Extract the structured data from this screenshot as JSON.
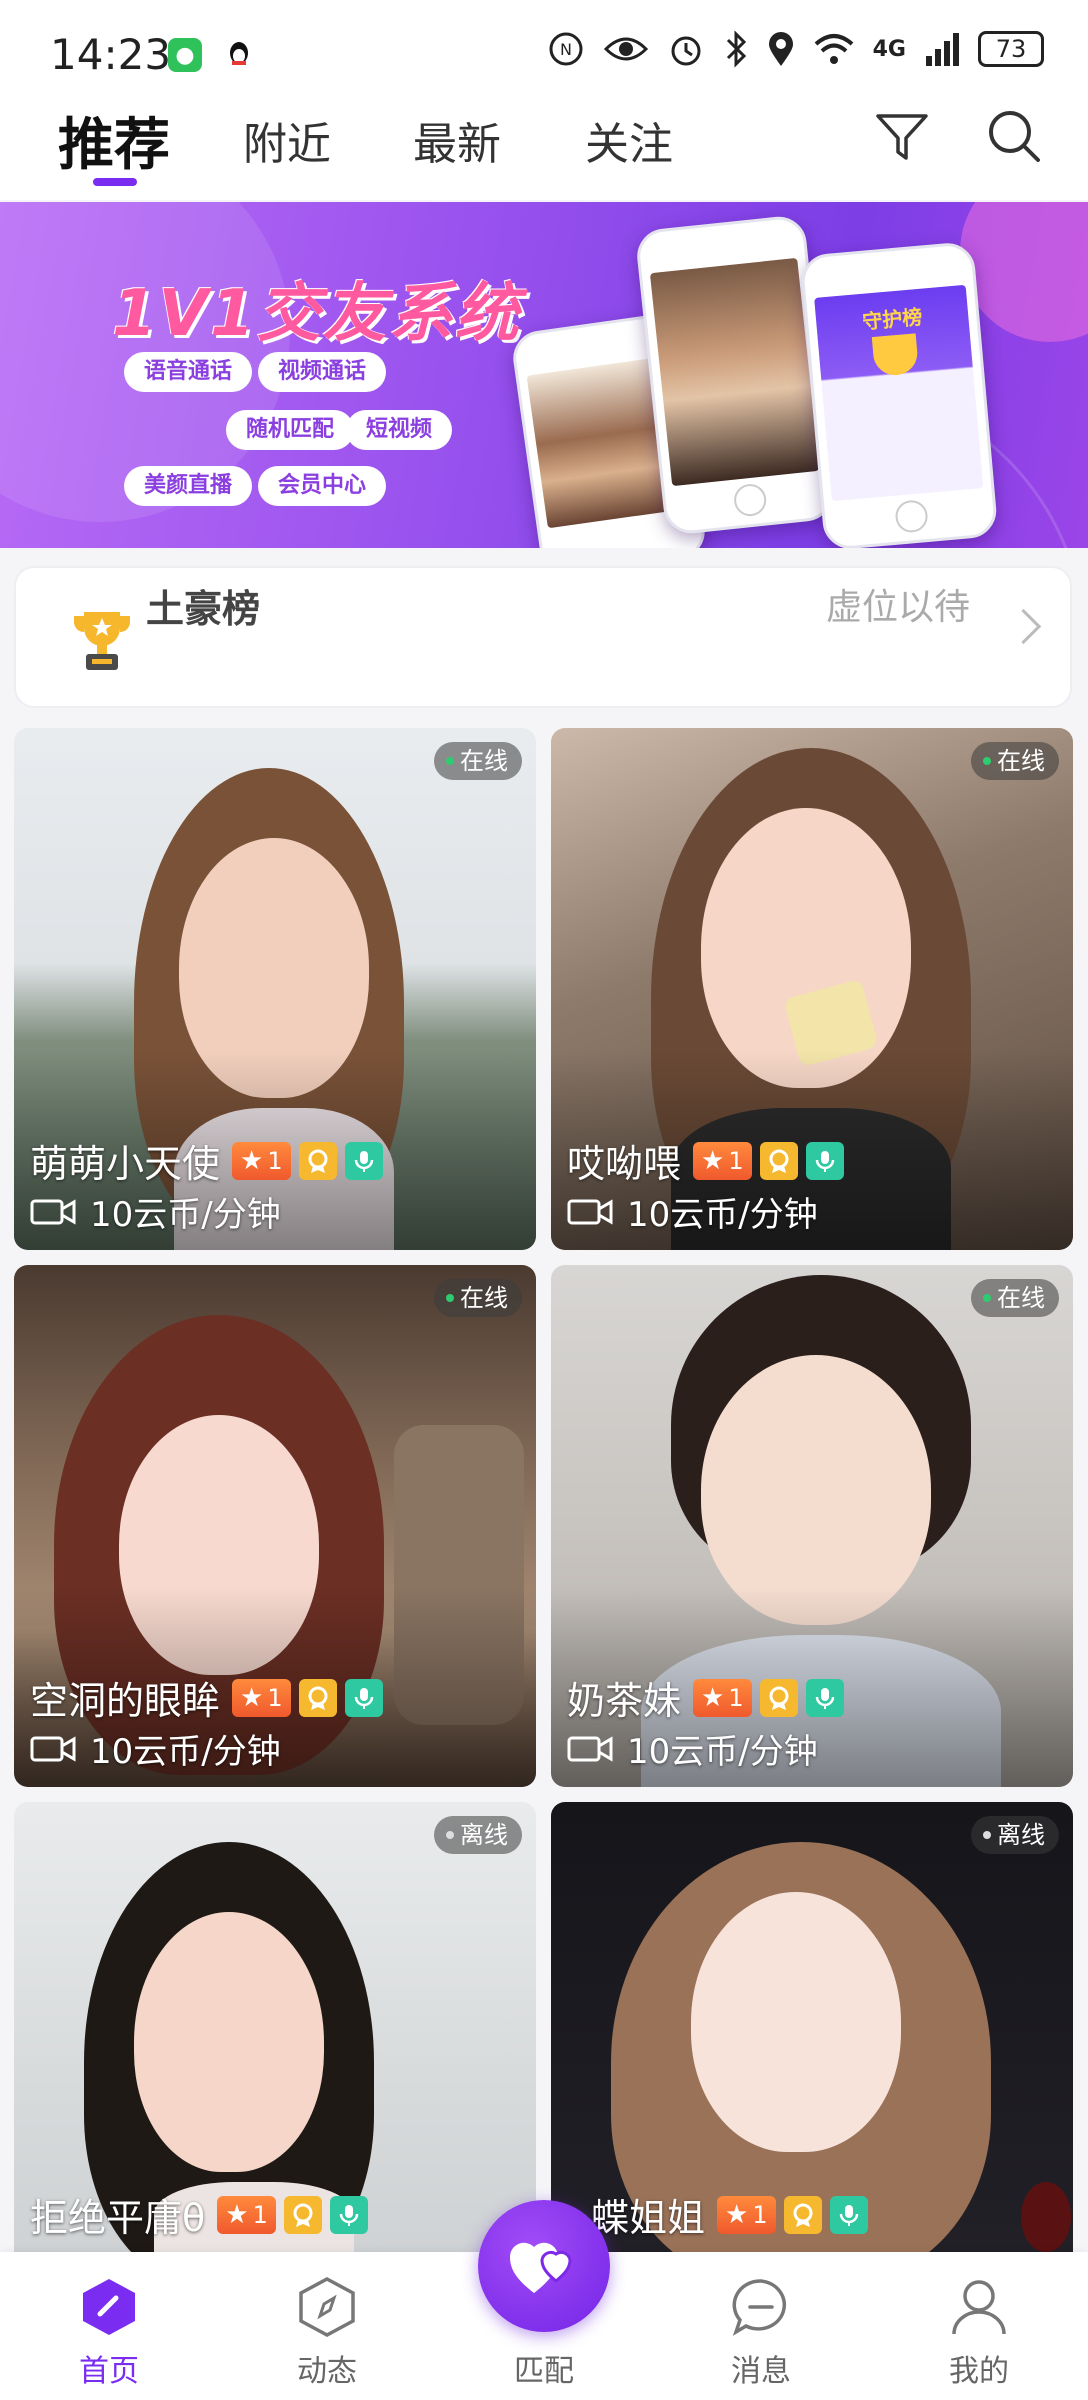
{
  "status_bar": {
    "time": "14:23",
    "network": "4G",
    "battery": "73"
  },
  "top_nav": {
    "tabs": [
      {
        "label": "推荐",
        "active": true
      },
      {
        "label": "附近",
        "active": false
      },
      {
        "label": "最新",
        "active": false
      },
      {
        "label": "关注",
        "active": false
      }
    ],
    "icons": [
      "filter-icon",
      "search-icon"
    ]
  },
  "banner": {
    "title": "1V1交友系统",
    "features": [
      "语音通话",
      "视频通话",
      "随机匹配",
      "短视频",
      "美颜直播",
      "会员中心"
    ],
    "phone_label": "守护榜"
  },
  "rich_list": {
    "title": "土豪榜",
    "status": "虚位以待"
  },
  "users": [
    {
      "name": "萌萌小天使",
      "level": "1",
      "status": "在线",
      "online": true,
      "price": "10云币/分钟"
    },
    {
      "name": "哎呦喂",
      "level": "1",
      "status": "在线",
      "online": true,
      "price": "10云币/分钟"
    },
    {
      "name": "空洞的眼眸",
      "level": "1",
      "status": "在线",
      "online": true,
      "price": "10云币/分钟"
    },
    {
      "name": "奶茶妹",
      "level": "1",
      "status": "在线",
      "online": true,
      "price": "10云币/分钟"
    },
    {
      "name": "拒绝平庸θ",
      "level": "1",
      "status": "离线",
      "online": false,
      "price": ""
    },
    {
      "name": "蝶姐姐",
      "level": "1",
      "status": "离线",
      "online": false,
      "price": ""
    }
  ],
  "bottom_nav": [
    {
      "label": "首页",
      "icon": "home-icon",
      "active": true
    },
    {
      "label": "动态",
      "icon": "compass-icon",
      "active": false
    },
    {
      "label": "匹配",
      "icon": "match-hearts-icon",
      "active": false
    },
    {
      "label": "消息",
      "icon": "chat-bubble-icon",
      "active": false
    },
    {
      "label": "我的",
      "icon": "profile-icon",
      "active": false
    }
  ],
  "colors": {
    "accent": "#7a2df0",
    "online": "#2ecc71",
    "offline": "#dddddd",
    "level_tag": "#f26a34",
    "badge_yellow": "#f5b82e",
    "badge_green": "#2ec9a0"
  }
}
